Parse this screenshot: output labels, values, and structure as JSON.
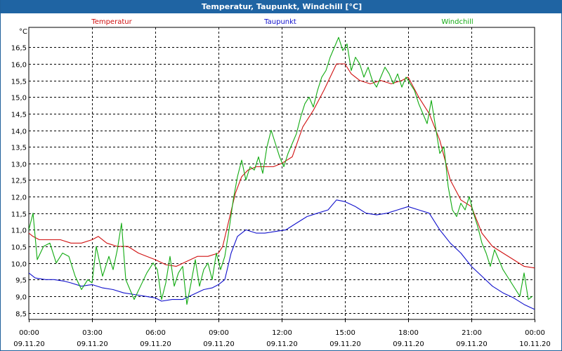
{
  "window": {
    "title": "Temperatur, Taupunkt, Windchill [°C]"
  },
  "chart_data": {
    "type": "line",
    "title": "Temperatur, Taupunkt, Windchill [°C]",
    "ylabel": "°C",
    "ylim": [
      8.3,
      17.1
    ],
    "yticks": [
      8.5,
      9.0,
      9.5,
      10.0,
      10.5,
      11.0,
      11.5,
      12.0,
      12.5,
      13.0,
      13.5,
      14.0,
      14.5,
      15.0,
      15.5,
      16.0,
      16.5
    ],
    "ytick_labels": [
      "8,5",
      "9,0",
      "9,5",
      "10,0",
      "10,5",
      "11,0",
      "11,5",
      "12,0",
      "12,5",
      "13,0",
      "13,5",
      "14,0",
      "14,5",
      "15,0",
      "15,5",
      "16,0",
      "16,5"
    ],
    "xlim": [
      0,
      24
    ],
    "xticks": [
      {
        "h": 0,
        "time": "00:00",
        "date": "09.11.20"
      },
      {
        "h": 3,
        "time": "03:00",
        "date": "09.11.20"
      },
      {
        "h": 6,
        "time": "06:00",
        "date": "09.11.20"
      },
      {
        "h": 9,
        "time": "09:00",
        "date": "09.11.20"
      },
      {
        "h": 12,
        "time": "12:00",
        "date": "09.11.20"
      },
      {
        "h": 15,
        "time": "15:00",
        "date": "09.11.20"
      },
      {
        "h": 18,
        "time": "18:00",
        "date": "09.11.20"
      },
      {
        "h": 21,
        "time": "21:00",
        "date": "09.11.20"
      },
      {
        "h": 24,
        "time": "00:00",
        "date": "10.11.20"
      }
    ],
    "grid": true,
    "series": [
      {
        "name": "Temperatur",
        "color": "#d01010",
        "points": [
          [
            0,
            10.9
          ],
          [
            0.2,
            10.8
          ],
          [
            0.5,
            10.7
          ],
          [
            1,
            10.7
          ],
          [
            1.5,
            10.7
          ],
          [
            2,
            10.6
          ],
          [
            2.5,
            10.6
          ],
          [
            3,
            10.7
          ],
          [
            3.3,
            10.8
          ],
          [
            3.7,
            10.6
          ],
          [
            4.2,
            10.5
          ],
          [
            4.7,
            10.5
          ],
          [
            5.2,
            10.3
          ],
          [
            5.6,
            10.2
          ],
          [
            6,
            10.1
          ],
          [
            6.5,
            9.95
          ],
          [
            7,
            9.9
          ],
          [
            7.5,
            10.05
          ],
          [
            8,
            10.2
          ],
          [
            8.5,
            10.2
          ],
          [
            9,
            10.3
          ],
          [
            9.2,
            10.5
          ],
          [
            9.5,
            11.3
          ],
          [
            9.8,
            12.1
          ],
          [
            10.1,
            12.6
          ],
          [
            10.4,
            12.8
          ],
          [
            10.8,
            12.9
          ],
          [
            11.2,
            12.9
          ],
          [
            11.6,
            12.9
          ],
          [
            12,
            13.0
          ],
          [
            12.5,
            13.2
          ],
          [
            13,
            14.1
          ],
          [
            13.5,
            14.6
          ],
          [
            14,
            15.2
          ],
          [
            14.3,
            15.6
          ],
          [
            14.6,
            16.0
          ],
          [
            15,
            16.0
          ],
          [
            15.3,
            15.7
          ],
          [
            15.7,
            15.5
          ],
          [
            16.2,
            15.4
          ],
          [
            16.7,
            15.5
          ],
          [
            17.2,
            15.4
          ],
          [
            17.7,
            15.5
          ],
          [
            18,
            15.6
          ],
          [
            18.5,
            15.0
          ],
          [
            19,
            14.5
          ],
          [
            19.5,
            13.7
          ],
          [
            20,
            12.5
          ],
          [
            20.5,
            11.9
          ],
          [
            21,
            11.7
          ],
          [
            21.5,
            10.9
          ],
          [
            22,
            10.5
          ],
          [
            22.5,
            10.3
          ],
          [
            23,
            10.1
          ],
          [
            23.5,
            9.9
          ],
          [
            24,
            9.85
          ]
        ]
      },
      {
        "name": "Taupunkt",
        "color": "#1010cc",
        "points": [
          [
            0,
            9.7
          ],
          [
            0.3,
            9.55
          ],
          [
            0.8,
            9.5
          ],
          [
            1.2,
            9.5
          ],
          [
            1.7,
            9.45
          ],
          [
            2,
            9.4
          ],
          [
            2.5,
            9.3
          ],
          [
            3,
            9.35
          ],
          [
            3.5,
            9.25
          ],
          [
            4,
            9.2
          ],
          [
            4.5,
            9.1
          ],
          [
            5,
            9.05
          ],
          [
            5.5,
            9.0
          ],
          [
            6,
            8.95
          ],
          [
            6.3,
            8.85
          ],
          [
            6.8,
            8.9
          ],
          [
            7.3,
            8.9
          ],
          [
            7.8,
            9.05
          ],
          [
            8.3,
            9.2
          ],
          [
            8.7,
            9.25
          ],
          [
            9,
            9.35
          ],
          [
            9.3,
            9.5
          ],
          [
            9.6,
            10.3
          ],
          [
            9.9,
            10.8
          ],
          [
            10.3,
            11.0
          ],
          [
            10.8,
            10.9
          ],
          [
            11.2,
            10.9
          ],
          [
            11.7,
            10.95
          ],
          [
            12.2,
            11.0
          ],
          [
            12.7,
            11.2
          ],
          [
            13.2,
            11.4
          ],
          [
            13.7,
            11.5
          ],
          [
            14.2,
            11.6
          ],
          [
            14.6,
            11.9
          ],
          [
            15,
            11.85
          ],
          [
            15.5,
            11.7
          ],
          [
            16,
            11.5
          ],
          [
            16.5,
            11.45
          ],
          [
            17,
            11.5
          ],
          [
            17.5,
            11.6
          ],
          [
            18,
            11.7
          ],
          [
            18.5,
            11.6
          ],
          [
            19,
            11.5
          ],
          [
            19.5,
            11.0
          ],
          [
            20,
            10.6
          ],
          [
            20.5,
            10.3
          ],
          [
            21,
            9.9
          ],
          [
            21.5,
            9.6
          ],
          [
            22,
            9.3
          ],
          [
            22.5,
            9.1
          ],
          [
            23,
            8.95
          ],
          [
            23.5,
            8.75
          ],
          [
            24,
            8.6
          ]
        ]
      },
      {
        "name": "Windchill",
        "color": "#10aa10",
        "points": [
          [
            0,
            11.0
          ],
          [
            0.2,
            11.5
          ],
          [
            0.4,
            10.1
          ],
          [
            0.7,
            10.5
          ],
          [
            1,
            10.6
          ],
          [
            1.3,
            10.0
          ],
          [
            1.6,
            10.3
          ],
          [
            1.9,
            10.2
          ],
          [
            2.2,
            9.6
          ],
          [
            2.5,
            9.2
          ],
          [
            2.8,
            9.5
          ],
          [
            3,
            9.4
          ],
          [
            3.2,
            10.5
          ],
          [
            3.5,
            9.6
          ],
          [
            3.8,
            10.2
          ],
          [
            4.0,
            9.8
          ],
          [
            4.2,
            10.4
          ],
          [
            4.4,
            11.2
          ],
          [
            4.6,
            9.5
          ],
          [
            4.8,
            9.2
          ],
          [
            5.0,
            8.9
          ],
          [
            5.3,
            9.3
          ],
          [
            5.6,
            9.7
          ],
          [
            5.9,
            10.0
          ],
          [
            6.1,
            9.8
          ],
          [
            6.3,
            8.9
          ],
          [
            6.5,
            9.4
          ],
          [
            6.7,
            10.2
          ],
          [
            6.9,
            9.3
          ],
          [
            7.1,
            9.7
          ],
          [
            7.3,
            9.9
          ],
          [
            7.5,
            8.75
          ],
          [
            7.7,
            9.4
          ],
          [
            7.9,
            10.1
          ],
          [
            8.1,
            9.3
          ],
          [
            8.3,
            9.8
          ],
          [
            8.5,
            10.0
          ],
          [
            8.7,
            9.5
          ],
          [
            8.9,
            10.3
          ],
          [
            9.1,
            9.8
          ],
          [
            9.3,
            10.2
          ],
          [
            9.5,
            11.0
          ],
          [
            9.7,
            11.9
          ],
          [
            9.9,
            12.6
          ],
          [
            10.1,
            13.1
          ],
          [
            10.3,
            12.5
          ],
          [
            10.5,
            12.9
          ],
          [
            10.7,
            12.8
          ],
          [
            10.9,
            13.2
          ],
          [
            11.1,
            12.7
          ],
          [
            11.3,
            13.5
          ],
          [
            11.5,
            14.0
          ],
          [
            11.7,
            13.6
          ],
          [
            11.9,
            13.2
          ],
          [
            12.1,
            12.9
          ],
          [
            12.3,
            13.3
          ],
          [
            12.5,
            13.6
          ],
          [
            12.7,
            13.9
          ],
          [
            12.9,
            14.4
          ],
          [
            13.1,
            14.8
          ],
          [
            13.3,
            15.0
          ],
          [
            13.5,
            14.7
          ],
          [
            13.7,
            15.2
          ],
          [
            13.9,
            15.6
          ],
          [
            14.1,
            15.8
          ],
          [
            14.3,
            16.2
          ],
          [
            14.5,
            16.5
          ],
          [
            14.7,
            16.8
          ],
          [
            14.9,
            16.4
          ],
          [
            15.1,
            16.6
          ],
          [
            15.3,
            15.8
          ],
          [
            15.5,
            16.2
          ],
          [
            15.7,
            16.0
          ],
          [
            15.9,
            15.6
          ],
          [
            16.1,
            15.9
          ],
          [
            16.3,
            15.5
          ],
          [
            16.5,
            15.3
          ],
          [
            16.7,
            15.6
          ],
          [
            16.9,
            15.9
          ],
          [
            17.1,
            15.7
          ],
          [
            17.3,
            15.4
          ],
          [
            17.5,
            15.7
          ],
          [
            17.7,
            15.3
          ],
          [
            17.9,
            15.6
          ],
          [
            18.1,
            15.4
          ],
          [
            18.3,
            15.2
          ],
          [
            18.5,
            14.8
          ],
          [
            18.7,
            14.5
          ],
          [
            18.9,
            14.2
          ],
          [
            19.1,
            14.9
          ],
          [
            19.3,
            14.1
          ],
          [
            19.5,
            13.3
          ],
          [
            19.7,
            13.5
          ],
          [
            19.9,
            12.3
          ],
          [
            20.1,
            11.6
          ],
          [
            20.3,
            11.4
          ],
          [
            20.5,
            11.8
          ],
          [
            20.7,
            11.6
          ],
          [
            20.9,
            12.0
          ],
          [
            21.1,
            11.5
          ],
          [
            21.3,
            11.1
          ],
          [
            21.5,
            10.6
          ],
          [
            21.7,
            10.3
          ],
          [
            21.9,
            9.9
          ],
          [
            22.1,
            10.4
          ],
          [
            22.3,
            10.1
          ],
          [
            22.5,
            9.8
          ],
          [
            22.7,
            9.6
          ],
          [
            22.9,
            9.4
          ],
          [
            23.1,
            9.2
          ],
          [
            23.3,
            9.0
          ],
          [
            23.5,
            9.7
          ],
          [
            23.7,
            8.9
          ],
          [
            23.9,
            9.0
          ]
        ]
      }
    ]
  }
}
